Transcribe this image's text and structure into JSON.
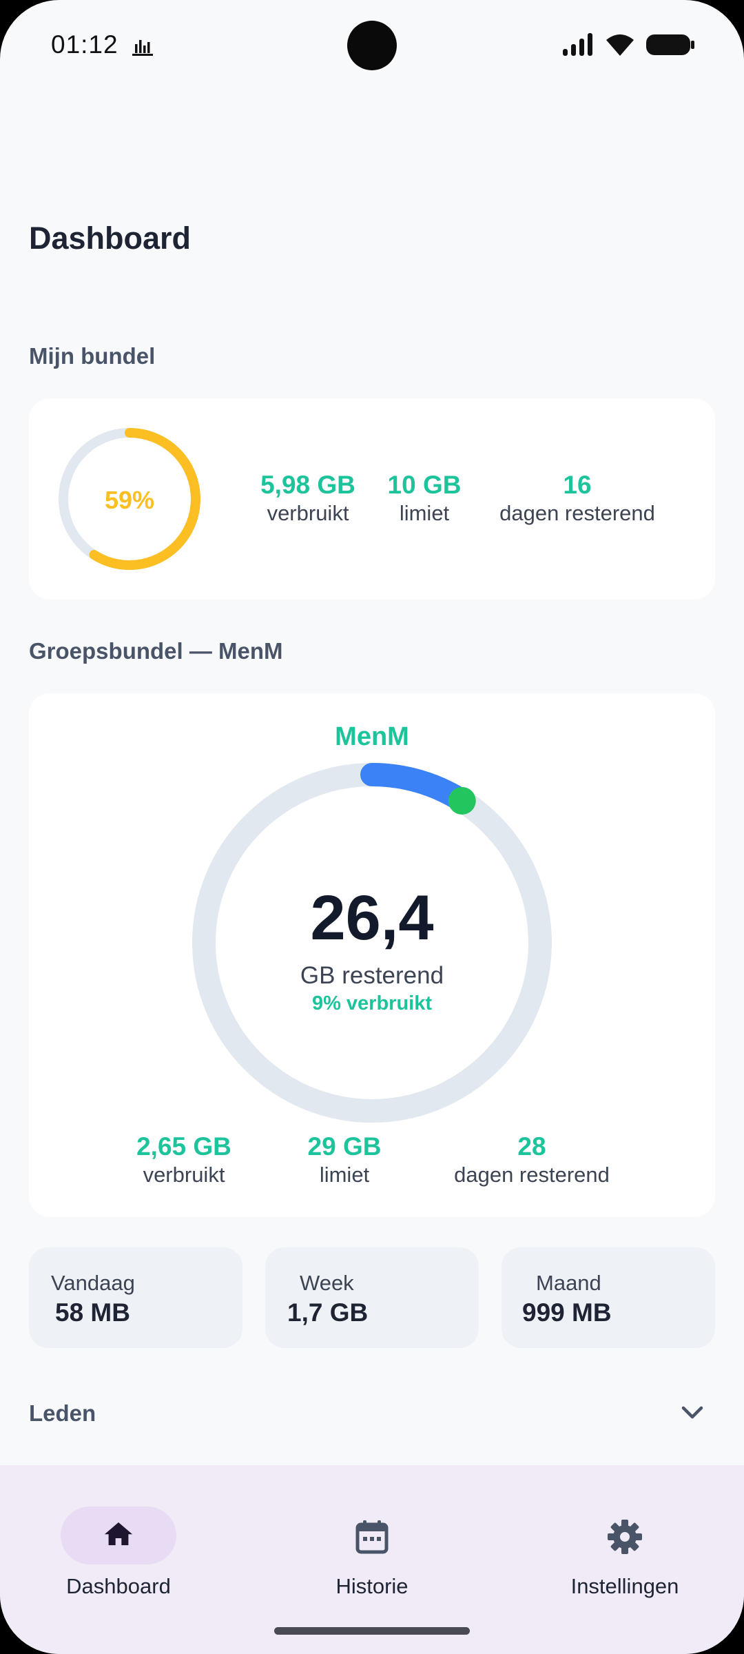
{
  "status_bar": {
    "time": "01:12"
  },
  "header": {
    "title": "Dashboard"
  },
  "my_bundle": {
    "section_label": "Mijn bundel",
    "percent_label": "59%",
    "percent_used": 59,
    "used_value": "5,98 GB",
    "used_label": "verbruikt",
    "limit_value": "10 GB",
    "limit_label": "limiet",
    "days_value": "16",
    "days_label": "dagen resterend",
    "colors": {
      "ring": "#fbbf24",
      "track": "#e2e8f0"
    }
  },
  "group_bundle": {
    "section_label": "Groepsbundel — MenM",
    "name": "MenM",
    "remaining_value": "26,4",
    "remaining_label": "GB resterend",
    "percent_used_label": "9% verbruikt",
    "percent_used": 9,
    "used_value": "2,65 GB",
    "used_label": "verbruikt",
    "limit_value": "29 GB",
    "limit_label": "limiet",
    "days_value": "28",
    "days_label": "dagen resterend",
    "colors": {
      "segment_main": "#3b82f6",
      "segment_end": "#22c55e",
      "track": "#e2e8f0",
      "accent": "#1cc39b"
    }
  },
  "tiles": [
    {
      "label": "Vandaag",
      "value": "58 MB"
    },
    {
      "label": "Week",
      "value": "1,7 GB"
    },
    {
      "label": "Maand",
      "value": "999 MB"
    }
  ],
  "members": {
    "label": "Leden",
    "icon": "chevron-down-icon"
  },
  "nav": {
    "items": [
      {
        "label": "Dashboard",
        "icon": "home-icon",
        "active": true
      },
      {
        "label": "Historie",
        "icon": "calendar-icon",
        "active": false
      },
      {
        "label": "Instellingen",
        "icon": "gear-icon",
        "active": false
      }
    ]
  }
}
